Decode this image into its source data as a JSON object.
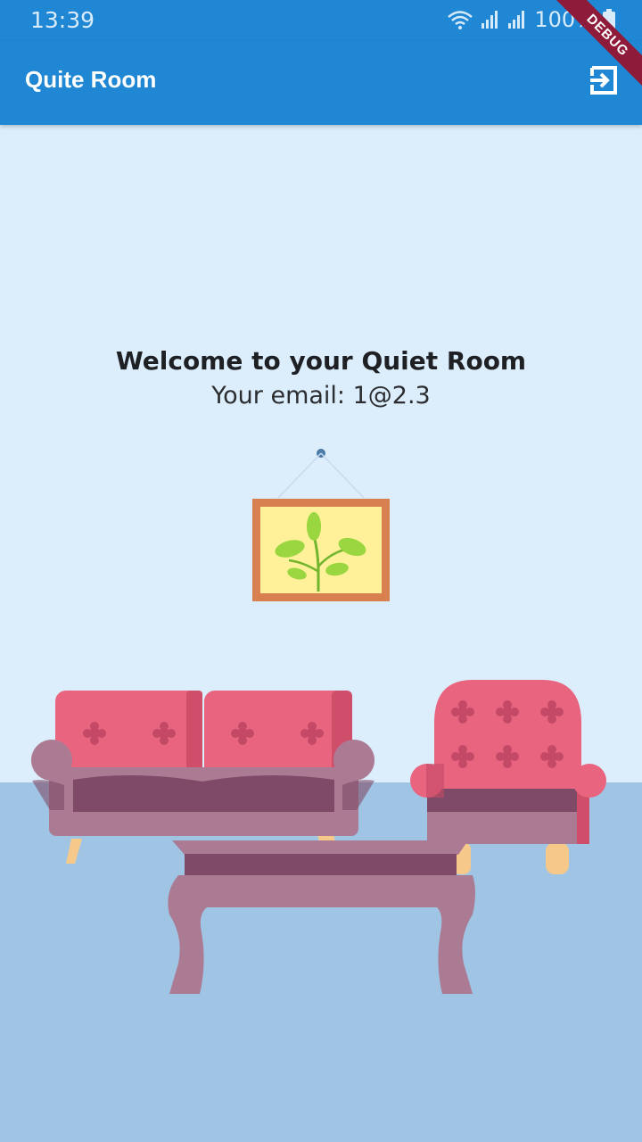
{
  "status_bar": {
    "time": "13:39",
    "battery": "100%"
  },
  "app_bar": {
    "title": "Quite Room",
    "logout_icon": "exit-to-app-icon"
  },
  "debug_banner": "DEBUG",
  "main": {
    "welcome": "Welcome to your Quiet Room",
    "email_line": "Your email: 1@2.3"
  },
  "colors": {
    "primary": "#1f87d3",
    "wall": "#dcedfb",
    "floor": "#a0c5e4",
    "cushion": "#e9657f",
    "frame": "#d98050"
  }
}
